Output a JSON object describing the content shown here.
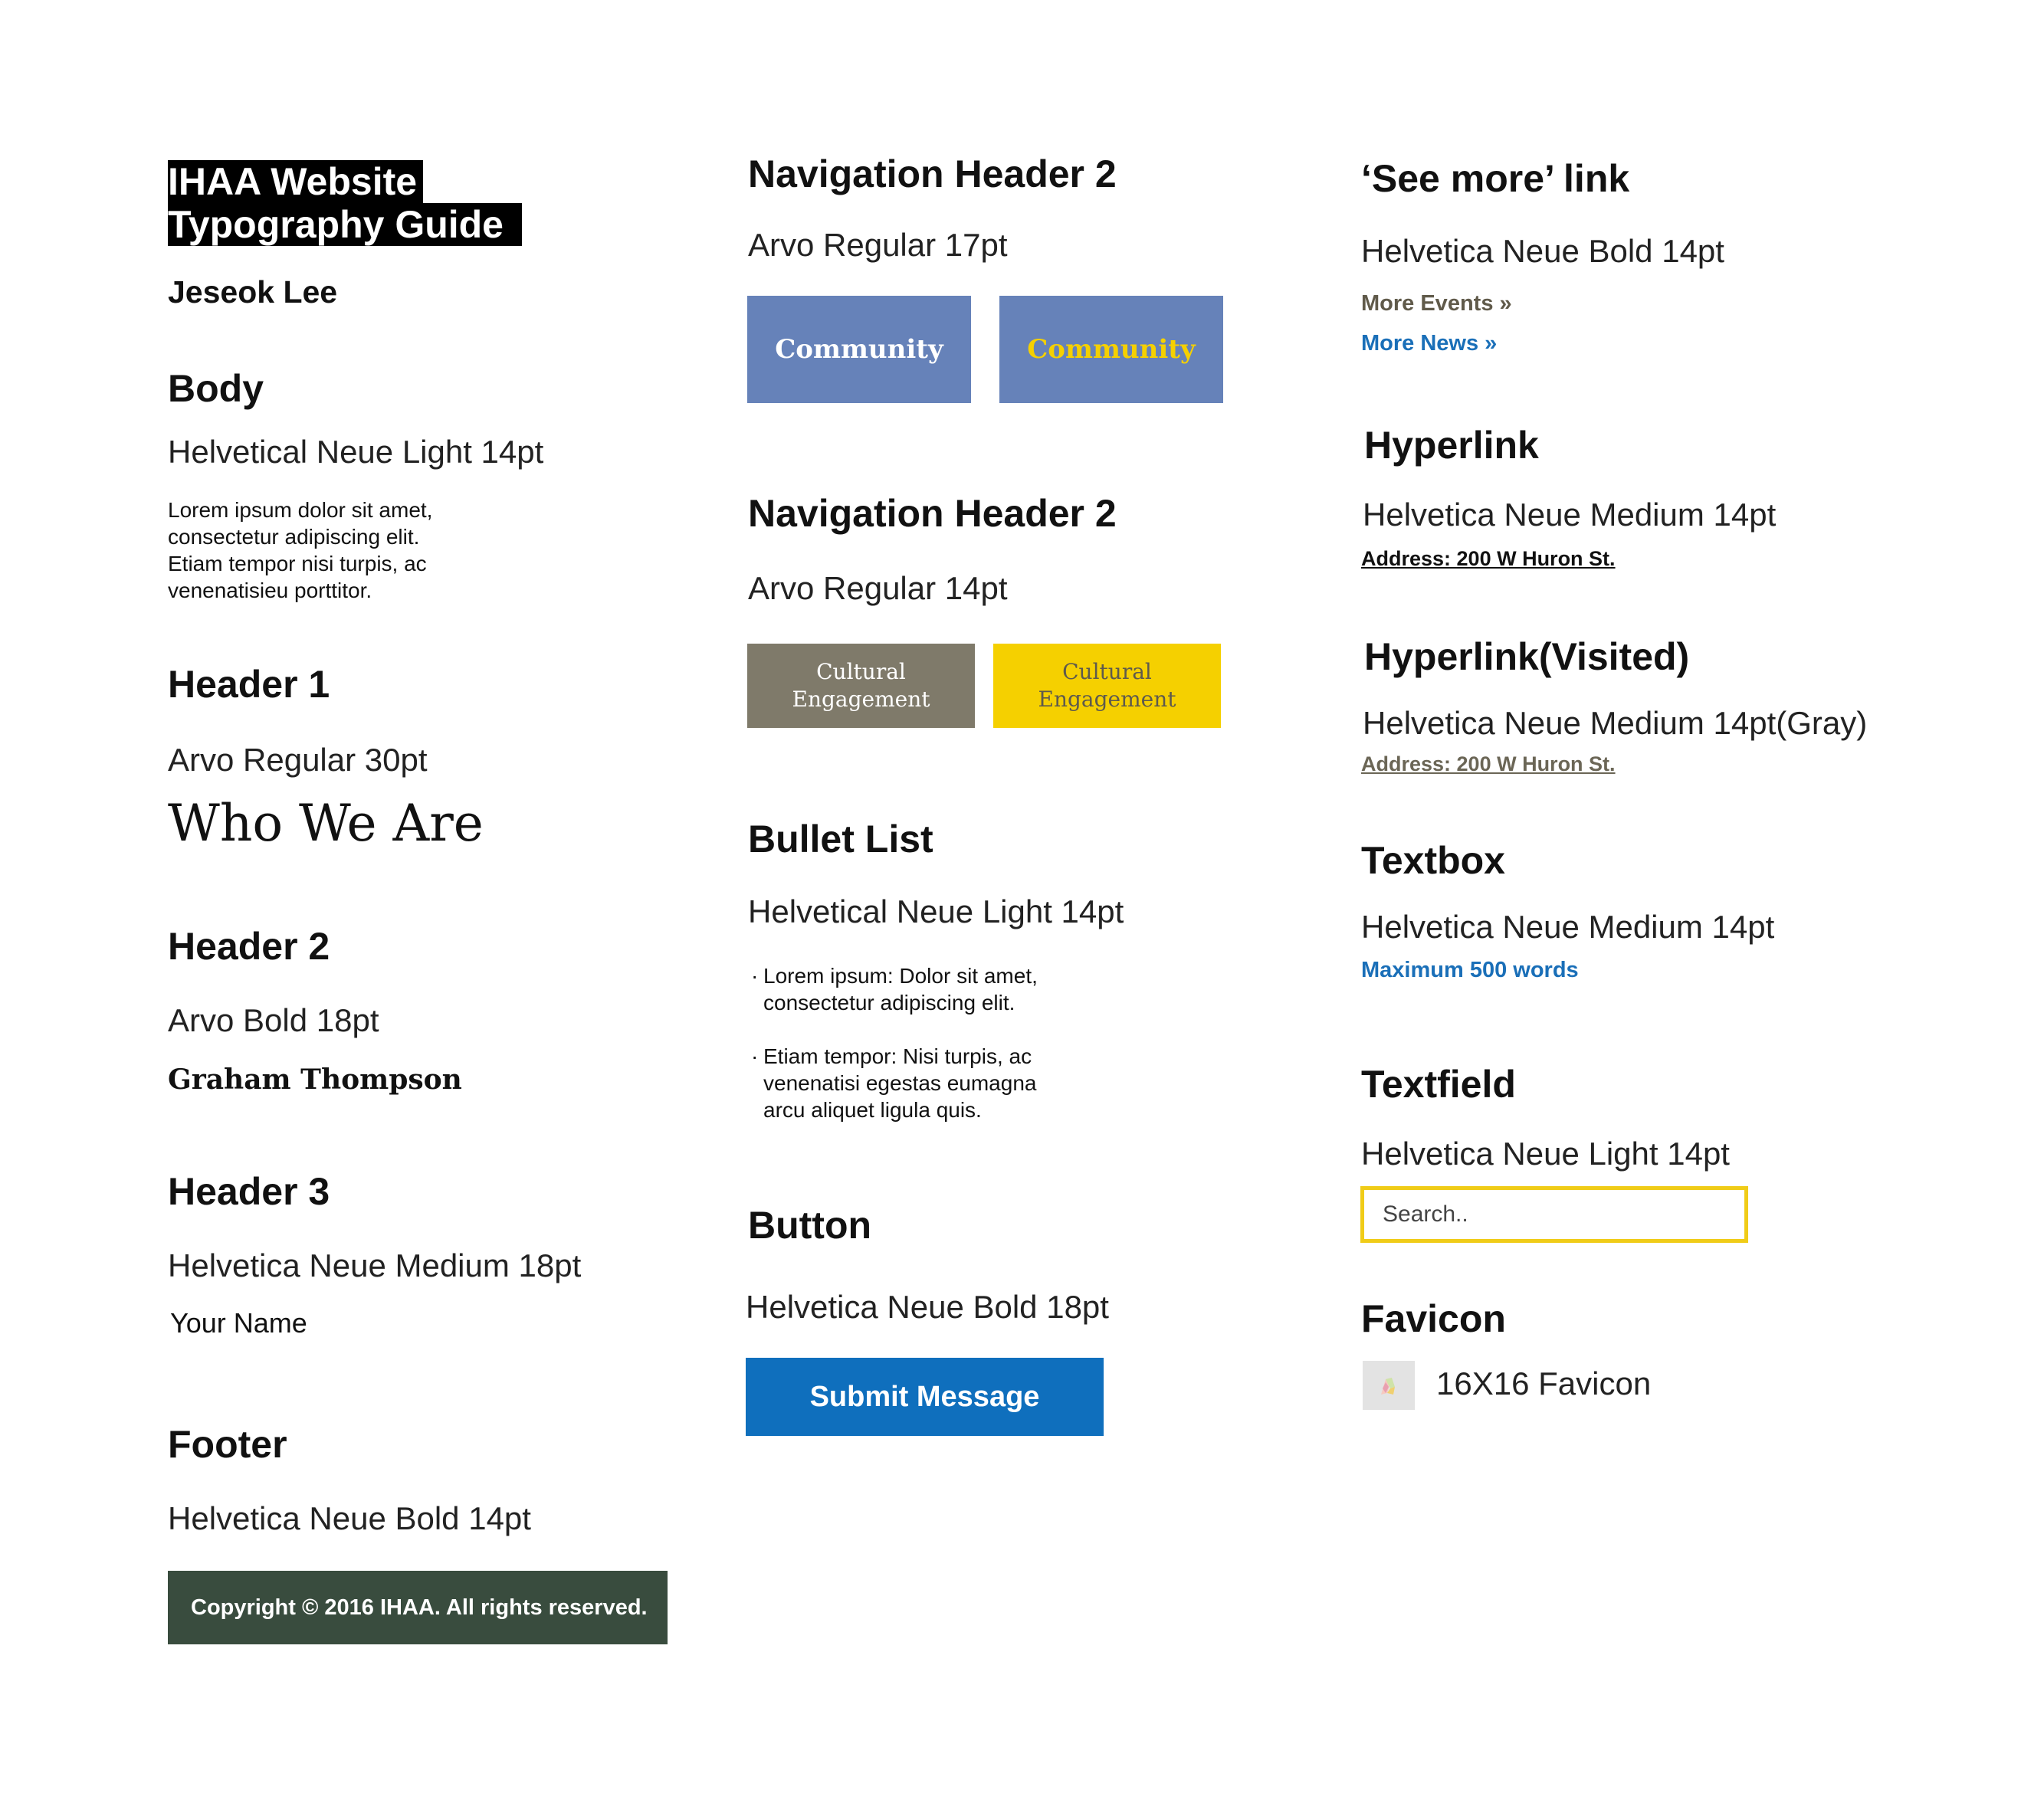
{
  "title": {
    "line1": "IHAA Website",
    "line2": "Typography Guide",
    "author": "Jeseok Lee"
  },
  "body_section": {
    "heading": "Body",
    "spec": "Helvetical Neue Light 14pt",
    "sample": "Lorem ipsum dolor sit amet, consectetur adipiscing elit. Etiam tempor nisi turpis, ac venenatisieu porttitor."
  },
  "header1": {
    "heading": "Header 1",
    "spec": "Arvo Regular 30pt",
    "sample": "Who We Are"
  },
  "header2": {
    "heading": "Header 2",
    "spec": "Arvo Bold 18pt",
    "sample": "Graham Thompson"
  },
  "header3": {
    "heading": "Header 3",
    "spec": "Helvetica Neue Medium 18pt",
    "sample": "Your Name"
  },
  "footer": {
    "heading": "Footer",
    "spec": "Helvetica Neue Bold 14pt",
    "sample": "Copyright © 2016 IHAA. All rights reserved."
  },
  "nav_header_a": {
    "heading": "Navigation Header 2",
    "spec": "Arvo Regular 17pt",
    "button_default": "Community",
    "button_active": "Community"
  },
  "nav_header_b": {
    "heading": "Navigation Header 2",
    "spec": "Arvo Regular 14pt",
    "button_default": "Cultural Engagement",
    "button_active": "Cultural Engagement"
  },
  "bullet_list": {
    "heading": "Bullet List",
    "spec": "Helvetical Neue Light 14pt",
    "items": [
      "Lorem ipsum: Dolor sit amet, consectetur adipiscing elit.",
      "Etiam tempor: Nisi turpis, ac venenatisi egestas eumagna arcu aliquet ligula quis."
    ]
  },
  "button_section": {
    "heading": "Button",
    "spec": "Helvetica Neue Bold 18pt",
    "sample": "Submit Message"
  },
  "see_more": {
    "heading": "‘See more’ link",
    "spec": "Helvetica Neue Bold 14pt",
    "link_events": "More Events »",
    "link_news": "More News »"
  },
  "hyperlink": {
    "heading": "Hyperlink",
    "spec": "Helvetica Neue Medium 14pt",
    "sample": "Address: 200 W Huron St."
  },
  "hyperlink_visited": {
    "heading": "Hyperlink(Visited)",
    "spec": "Helvetica Neue Medium 14pt(Gray)",
    "sample": "Address: 200 W Huron St."
  },
  "textbox": {
    "heading": "Textbox",
    "spec": "Helvetica Neue Medium 14pt",
    "sample": "Maximum 500 words"
  },
  "textfield": {
    "heading": "Textfield",
    "spec": "Helvetica Neue Light 14pt",
    "placeholder": "Search.."
  },
  "favicon": {
    "heading": "Favicon",
    "label": "16X16 Favicon",
    "icon": "favicon-icon"
  },
  "colors": {
    "nav_blue": "#6682b9",
    "nav_gray": "#7f7a6a",
    "yellow": "#f5d000",
    "button_blue": "#0f6fbd",
    "footer_green": "#394c3e",
    "link_blue": "#1a6fb8",
    "link_olive": "#605a4a"
  }
}
